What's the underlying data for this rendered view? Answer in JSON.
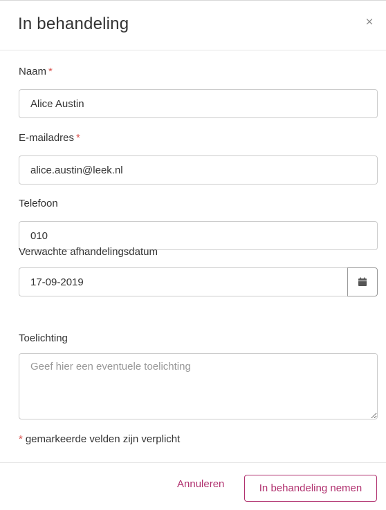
{
  "dialog": {
    "title": "In behandeling",
    "close_symbol": "×"
  },
  "form": {
    "name": {
      "label": "Naam",
      "required_marker": "*",
      "value": "Alice Austin"
    },
    "email": {
      "label": "E-mailadres",
      "required_marker": "*",
      "value": "alice.austin@leek.nl"
    },
    "phone": {
      "label": "Telefoon",
      "value": "010"
    },
    "expected_date": {
      "label": "Verwachte afhandelingsdatum",
      "value": "17-09-2019",
      "icon": "calendar-icon"
    },
    "comment": {
      "label": "Toelichting",
      "placeholder": "Geef hier een eventuele toelichting",
      "value": ""
    },
    "required_note": {
      "marker": "*",
      "text": "gemarkeerde velden zijn verplicht"
    }
  },
  "footer": {
    "cancel_label": "Annuleren",
    "submit_label": "In behandeling nemen"
  },
  "colors": {
    "accent": "#b0306e",
    "required": "#d9534f",
    "border": "#cccccc"
  }
}
